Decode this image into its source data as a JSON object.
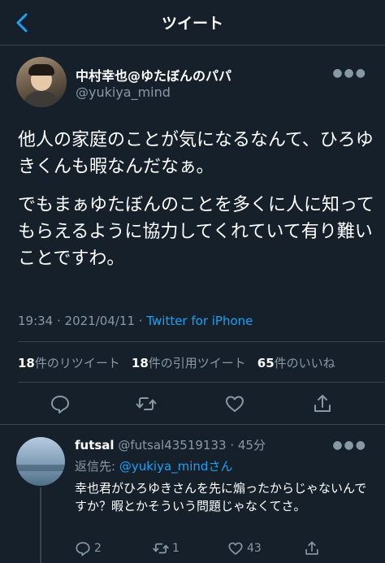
{
  "header": {
    "title": "ツイート",
    "back_icon": "chevron-left-icon"
  },
  "tweet": {
    "display_name": "中村幸也@ゆたぼんのパパ",
    "handle": "@yukiya_mind",
    "text_paragraphs": [
      "他人の家庭のことが気になるなんて、ひろゆきくんも暇なんだなぁ。",
      "でもまぁゆたぼんのことを多くに人に知ってもらえるように協力してくれていて有り難いことですわ。"
    ],
    "time": "19:34",
    "date_sep": " · ",
    "date": "2021/04/11",
    "client": "Twitter for iPhone",
    "stats": {
      "retweets_count": "18",
      "retweets_label": "件のリツイート",
      "quotes_count": "18",
      "quotes_label": "件の引用ツイート",
      "likes_count": "65",
      "likes_label": "件のいいね"
    }
  },
  "reply": {
    "display_name": "futsal",
    "handle": "@futsal43519133",
    "age": "· 45分",
    "replying_prefix": "返信先: ",
    "replying_to": "@yukiya_mindさん",
    "text": "幸也君がひろゆきさんを先に煽ったからじゃないんですか？暇とかそういう問題じゃなくてさ。",
    "reply_count": "2",
    "retweet_count": "1",
    "like_count": "43"
  },
  "colors": {
    "background": "#15202b",
    "accent": "#1da1f2",
    "muted": "#8899a6",
    "divider": "#38444d"
  }
}
